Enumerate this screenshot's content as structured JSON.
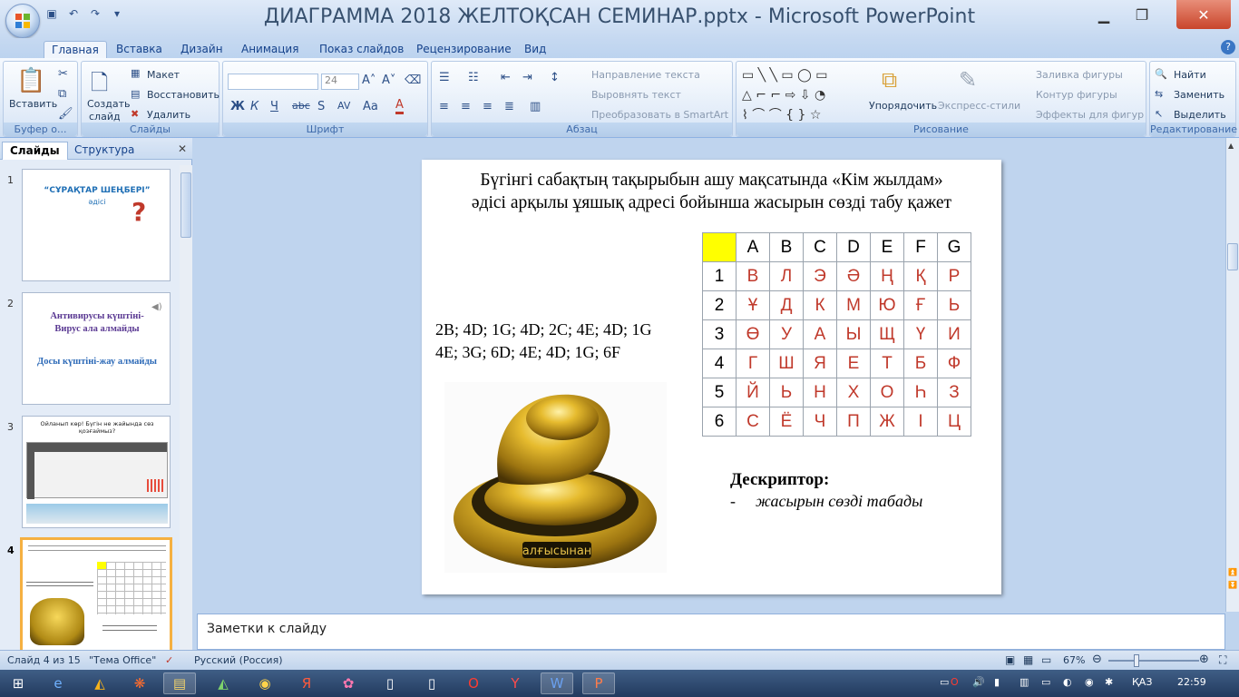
{
  "window": {
    "title": "ДИАГРАММА 2018 ЖЕЛТОҚСАН СЕМИНАР.pptx - Microsoft PowerPoint"
  },
  "tabs": [
    "Главная",
    "Вставка",
    "Дизайн",
    "Анимация",
    "Показ слайдов",
    "Рецензирование",
    "Вид"
  ],
  "ribbon": {
    "clipboard": {
      "label": "Буфер о...",
      "paste": "Вставить"
    },
    "slides": {
      "label": "Слайды",
      "new_slide": "Создать",
      "new_slide2": "слайд",
      "layout": "Макет",
      "reset": "Восстановить",
      "delete": "Удалить"
    },
    "font": {
      "label": "Шрифт",
      "size": "24"
    },
    "paragraph": {
      "label": "Абзац",
      "text_direction": "Направление текста",
      "align_text": "Выровнять текст",
      "smartart": "Преобразовать в SmartArt"
    },
    "drawing": {
      "label": "Рисование",
      "arrange": "Упорядочить",
      "quick_styles": "Экспресс-стили",
      "fill": "Заливка фигуры",
      "outline": "Контур фигуры",
      "effects": "Эффекты для фигур"
    },
    "editing": {
      "label": "Редактирование",
      "find": "Найти",
      "replace": "Заменить",
      "select": "Выделить"
    }
  },
  "left_panel": {
    "tab_slides": "Слайды",
    "tab_outline": "Структура"
  },
  "thumbnails": {
    "t1": {
      "num": "1",
      "title": "“СҰРАҚТАР ШЕҢБЕРІ”",
      "sub": "әдісі"
    },
    "t2": {
      "num": "2",
      "line1": "Антивирусы күштіні-",
      "line2": "Вирус ала алмайды",
      "line3": "Досы күштіні-жау алмайды"
    },
    "t3": {
      "num": "3",
      "title": "Ойланып көр! Бүгін не жайында сөз қозғаймыз?"
    },
    "t4": {
      "num": "4"
    }
  },
  "slide": {
    "title_line1": "Бүгінгі сабақтың тақырыбын ашу мақсатында «Кім жылдам»",
    "title_line2": "әдісі арқылы ұяшық адресі бойынша жасырын сөзді табу қажет",
    "codes_line1": "2B; 4D; 1G; 4D; 2C; 4E; 4D; 1G",
    "codes_line2": "4E; 3G; 6D; 4E; 4D; 1G; 6F",
    "grid_header": [
      "",
      "A",
      "B",
      "C",
      "D",
      "E",
      "F",
      "G"
    ],
    "grid_rows": [
      [
        "1",
        "В",
        "Л",
        "Э",
        "Ә",
        "Ң",
        "Қ",
        "Р"
      ],
      [
        "2",
        "Ұ",
        "Д",
        "К",
        "М",
        "Ю",
        "Ғ",
        "Ь"
      ],
      [
        "3",
        "Ө",
        "У",
        "А",
        "Ы",
        "Щ",
        "Ү",
        "И"
      ],
      [
        "4",
        "Г",
        "Ш",
        "Я",
        "Е",
        "Т",
        "Б",
        "Ф"
      ],
      [
        "5",
        "Й",
        "Ь",
        "Н",
        "Х",
        "О",
        "Һ",
        "З"
      ],
      [
        "6",
        "С",
        "Ё",
        "Ч",
        "П",
        "Ж",
        "І",
        "Ц"
      ]
    ],
    "desc_title": "Дескриптор:",
    "desc_item": "жасырын сөзді табады",
    "award_text": "алғысынан"
  },
  "notes": {
    "placeholder": "Заметки к слайду"
  },
  "status": {
    "slide": "Слайд 4 из 15",
    "theme": "\"Тема Office\"",
    "lang": "Русский (Россия)",
    "zoom": "67%"
  },
  "taskbar": {
    "lang": "ҚАЗ",
    "time": "22:59"
  }
}
